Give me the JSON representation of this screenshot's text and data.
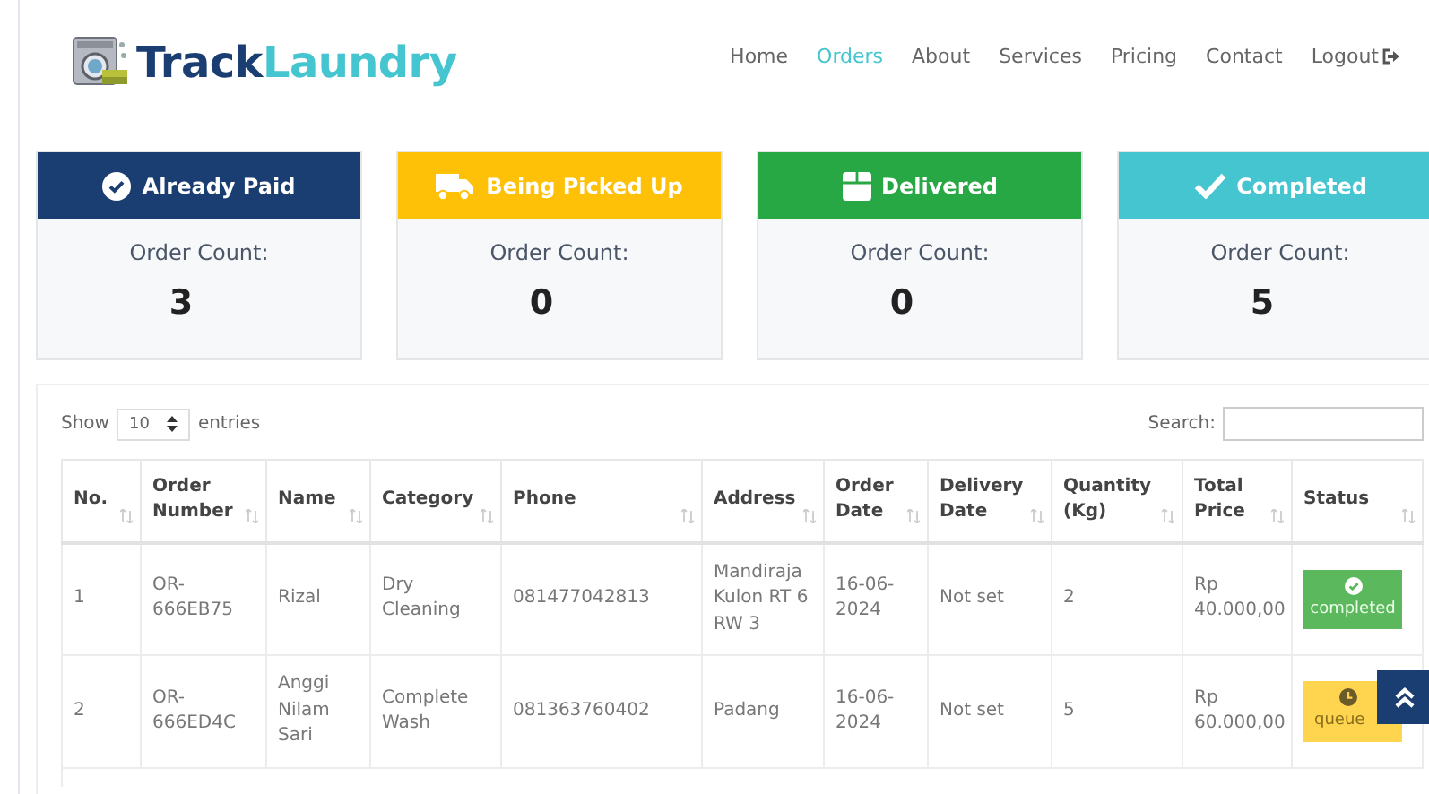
{
  "brand": {
    "part_1": "Track",
    "part_2": "Laundry"
  },
  "nav": [
    {
      "label": "Home",
      "selected": false
    },
    {
      "label": "Orders",
      "selected": true
    },
    {
      "label": "About",
      "selected": false
    },
    {
      "label": "Services",
      "selected": false
    },
    {
      "label": "Pricing",
      "selected": false
    },
    {
      "label": "Contact",
      "selected": false
    },
    {
      "label": "Logout",
      "selected": false,
      "kind": "logout"
    }
  ],
  "cards": [
    {
      "title": "Already Paid",
      "kind": "check-circle",
      "color": "#1b3e72",
      "label": "Order Count:",
      "count": "3"
    },
    {
      "title": "Being Picked Up",
      "kind": "truck",
      "color": "#ffc107",
      "label": "Order Count:",
      "count": "0"
    },
    {
      "title": "Delivered",
      "kind": "box",
      "color": "#28a745",
      "label": "Order Count:",
      "count": "0"
    },
    {
      "title": "Completed",
      "kind": "check",
      "color": "#45c5cf",
      "label": "Order Count:",
      "count": "5"
    }
  ],
  "table_controls": {
    "show_label": "Show",
    "page_size": "10",
    "entries_label": "entries",
    "search_label": "Search:"
  },
  "table": {
    "columns": [
      "No.",
      "Order Number",
      "Name",
      "Category",
      "Phone",
      "Address",
      "Order Date",
      "Delivery Date",
      "Quantity (Kg)",
      "Total Price",
      "Status"
    ],
    "rows": [
      {
        "cells": [
          "1",
          "OR-666EB75",
          "Rizal",
          "Dry Cleaning",
          "081477042813",
          "Mandiraja Kulon RT 6 RW 3",
          "16-06-2024",
          "Not set",
          "2",
          "Rp 40.000,00"
        ],
        "status": {
          "kind": "completed",
          "label": "completed"
        }
      },
      {
        "cells": [
          "2",
          "OR-666ED4C",
          "Anggi Nilam Sari",
          "Complete Wash",
          "081363760402",
          "Padang",
          "16-06-2024",
          "Not set",
          "5",
          "Rp 60.000,00"
        ],
        "status": {
          "kind": "queue",
          "label": "queue"
        }
      }
    ]
  }
}
